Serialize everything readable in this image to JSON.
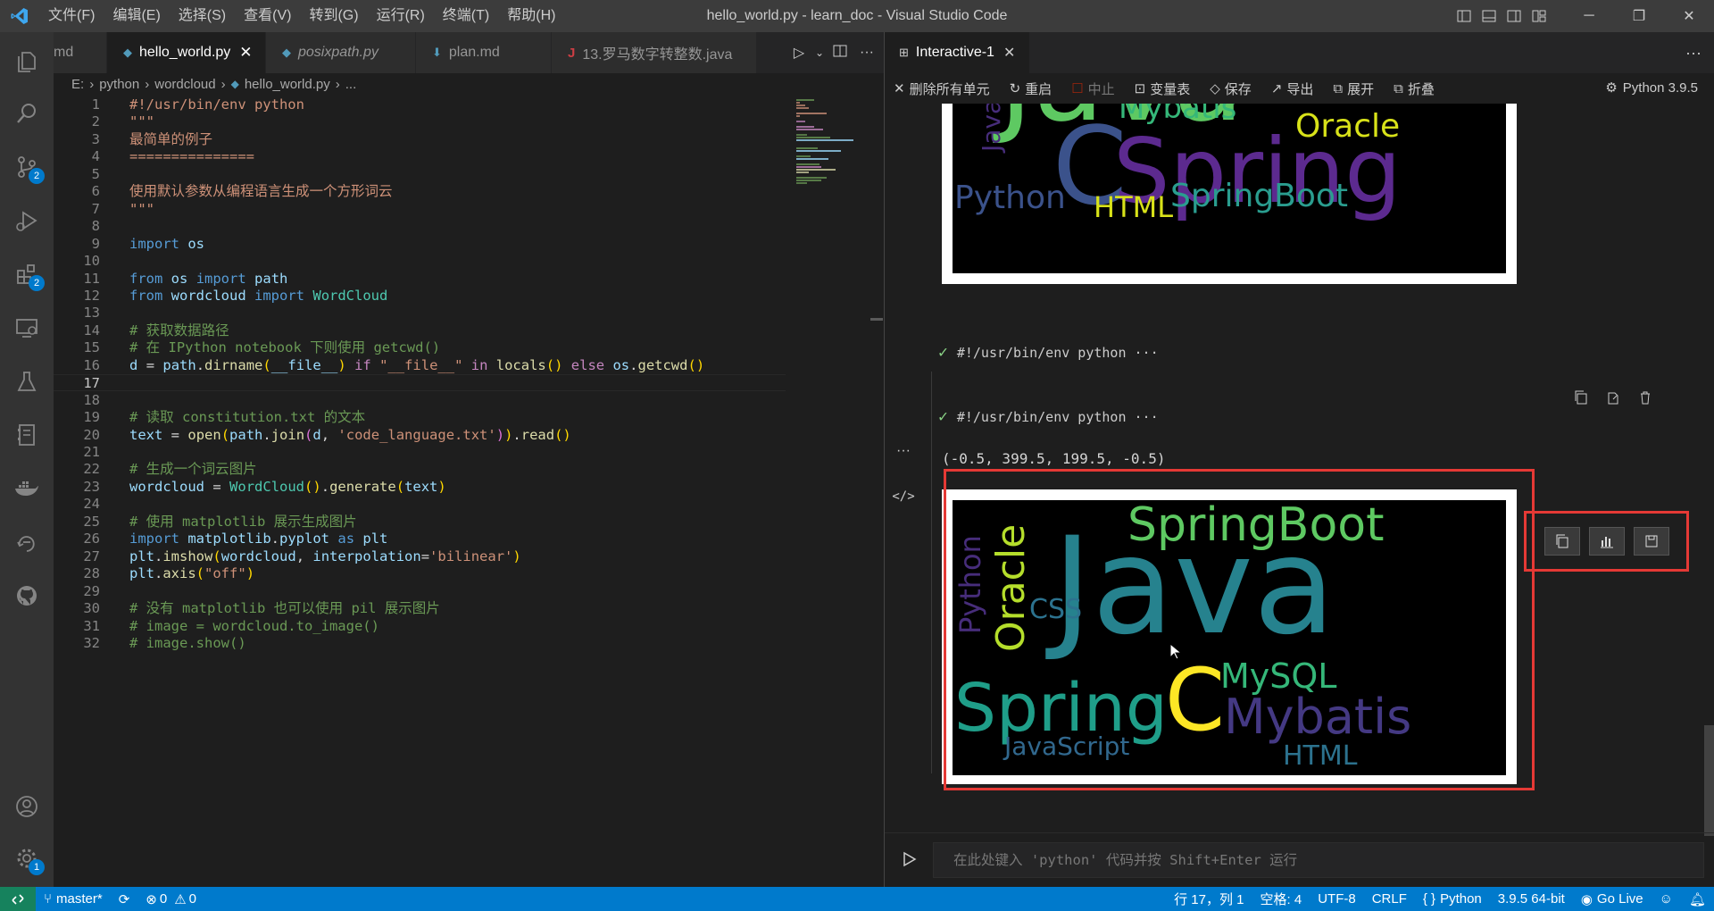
{
  "window": {
    "title": "hello_world.py - learn_doc - Visual Studio Code",
    "menu": [
      "文件(F)",
      "编辑(E)",
      "选择(S)",
      "查看(V)",
      "转到(G)",
      "运行(R)",
      "终端(T)",
      "帮助(H)"
    ],
    "controls": [
      "─",
      "❐",
      "✕"
    ]
  },
  "activity_bar": {
    "items": [
      {
        "name": "explorer",
        "badge": ""
      },
      {
        "name": "search",
        "badge": ""
      },
      {
        "name": "source-control",
        "badge": "2"
      },
      {
        "name": "run-debug",
        "badge": ""
      },
      {
        "name": "extensions",
        "badge": "2"
      },
      {
        "name": "remote-explorer",
        "badge": ""
      },
      {
        "name": "testing",
        "badge": ""
      },
      {
        "name": "notebook",
        "badge": ""
      },
      {
        "name": "docker",
        "badge": ""
      },
      {
        "name": "timeline",
        "badge": ""
      },
      {
        "name": "github",
        "badge": ""
      }
    ],
    "bottom": [
      {
        "name": "accounts",
        "badge": ""
      },
      {
        "name": "manage",
        "badge": "1"
      }
    ]
  },
  "editor": {
    "tabs": [
      {
        "label": "md",
        "icon": "",
        "active": false,
        "italic": false
      },
      {
        "label": "hello_world.py",
        "icon": "python",
        "active": true,
        "italic": false
      },
      {
        "label": "posixpath.py",
        "icon": "python",
        "active": false,
        "italic": true
      },
      {
        "label": "plan.md",
        "icon": "markdown",
        "active": false,
        "italic": false
      },
      {
        "label": "13.罗马数字转整数.java",
        "icon": "java",
        "active": false,
        "italic": false
      }
    ],
    "breadcrumb": [
      "E:",
      "python",
      "wordcloud",
      "hello_world.py",
      "..."
    ],
    "current_line": 17
  },
  "code_lines": [
    {
      "n": "1",
      "t": "#!/usr/bin/env python"
    },
    {
      "n": "2",
      "t": "\"\"\""
    },
    {
      "n": "3",
      "t": "最简单的例子"
    },
    {
      "n": "4",
      "t": "==============="
    },
    {
      "n": "5",
      "t": ""
    },
    {
      "n": "6",
      "t": "使用默认参数从编程语言生成一个方形词云"
    },
    {
      "n": "7",
      "t": "\"\"\""
    },
    {
      "n": "8",
      "t": ""
    },
    {
      "n": "9",
      "t": "import os"
    },
    {
      "n": "10",
      "t": ""
    },
    {
      "n": "11",
      "t": "from os import path"
    },
    {
      "n": "12",
      "t": "from wordcloud import WordCloud"
    },
    {
      "n": "13",
      "t": ""
    },
    {
      "n": "14",
      "t": "# 获取数据路径"
    },
    {
      "n": "15",
      "t": "# 在 IPython notebook 下则使用 getcwd()"
    },
    {
      "n": "16",
      "t": "d = path.dirname(__file__) if \"__file__\" in locals() else os.getcwd()"
    },
    {
      "n": "17",
      "t": ""
    },
    {
      "n": "18",
      "t": ""
    },
    {
      "n": "19",
      "t": "# 读取 constitution.txt 的文本"
    },
    {
      "n": "20",
      "t": "text = open(path.join(d, 'code_language.txt')).read()"
    },
    {
      "n": "21",
      "t": ""
    },
    {
      "n": "22",
      "t": "# 生成一个词云图片"
    },
    {
      "n": "23",
      "t": "wordcloud = WordCloud().generate(text)"
    },
    {
      "n": "24",
      "t": ""
    },
    {
      "n": "25",
      "t": "# 使用 matplotlib 展示生成图片"
    },
    {
      "n": "26",
      "t": "import matplotlib.pyplot as plt"
    },
    {
      "n": "27",
      "t": "plt.imshow(wordcloud, interpolation='bilinear')"
    },
    {
      "n": "28",
      "t": "plt.axis(\"off\")"
    },
    {
      "n": "29",
      "t": ""
    },
    {
      "n": "30",
      "t": "# 没有 matplotlib 也可以使用 pil 展示图片"
    },
    {
      "n": "31",
      "t": "# image = wordcloud.to_image()"
    },
    {
      "n": "32",
      "t": "# image.show()"
    }
  ],
  "interactive": {
    "tab_label": "Interactive-1",
    "toolbar": {
      "clear_all": "删除所有单元",
      "restart": "重启",
      "interrupt": "中止",
      "variables": "变量表",
      "save": "保存",
      "export": "导出",
      "expand": "展开",
      "collapse": "折叠",
      "kernel": "Python 3.9.5"
    },
    "cells": [
      {
        "label": "#!/usr/bin/env python ···"
      },
      {
        "label": "#!/usr/bin/env python ···"
      }
    ],
    "output_text": "(-0.5, 399.5, 199.5, -0.5)",
    "input_placeholder": "在此处键入 'python' 代码并按 Shift+Enter 运行"
  },
  "wordcloud_top": [
    {
      "text": "Java",
      "color": "#5ec962"
    },
    {
      "text": "Mybatis",
      "color": "#35b779"
    },
    {
      "text": "Oracle",
      "color": "#d8e219"
    },
    {
      "text": "C",
      "color": "#3b528b"
    },
    {
      "text": "Spring",
      "color": "#5c2a8f"
    },
    {
      "text": "JavaScr",
      "color": "#472d7b"
    },
    {
      "text": "Python",
      "color": "#3b528b"
    },
    {
      "text": "HTML",
      "color": "#d8e219"
    },
    {
      "text": "SpringBoot",
      "color": "#2a9d8f"
    }
  ],
  "wordcloud_bottom": [
    {
      "text": "SpringBoot",
      "color": "#5ec962"
    },
    {
      "text": "Java",
      "color": "#26828e"
    },
    {
      "text": "Python",
      "color": "#472d7b"
    },
    {
      "text": "Oracle",
      "color": "#b5de2b"
    },
    {
      "text": "CSS",
      "color": "#2c728e"
    },
    {
      "text": "MySQL",
      "color": "#35b779"
    },
    {
      "text": "Spring",
      "color": "#1f9e89"
    },
    {
      "text": "C",
      "color": "#fde725"
    },
    {
      "text": "Mybatis",
      "color": "#443983"
    },
    {
      "text": "JavaScript",
      "color": "#31688e"
    },
    {
      "text": "HTML",
      "color": "#2c728e"
    }
  ],
  "statusbar": {
    "branch": "master*",
    "sync": "⟳",
    "errors": "0",
    "warnings": "0",
    "cursor": "行 17，列 1",
    "spaces": "空格: 4",
    "encoding": "UTF-8",
    "eol": "CRLF",
    "language": "Python",
    "interpreter": "3.9.5 64-bit",
    "golive": "Go Live"
  }
}
